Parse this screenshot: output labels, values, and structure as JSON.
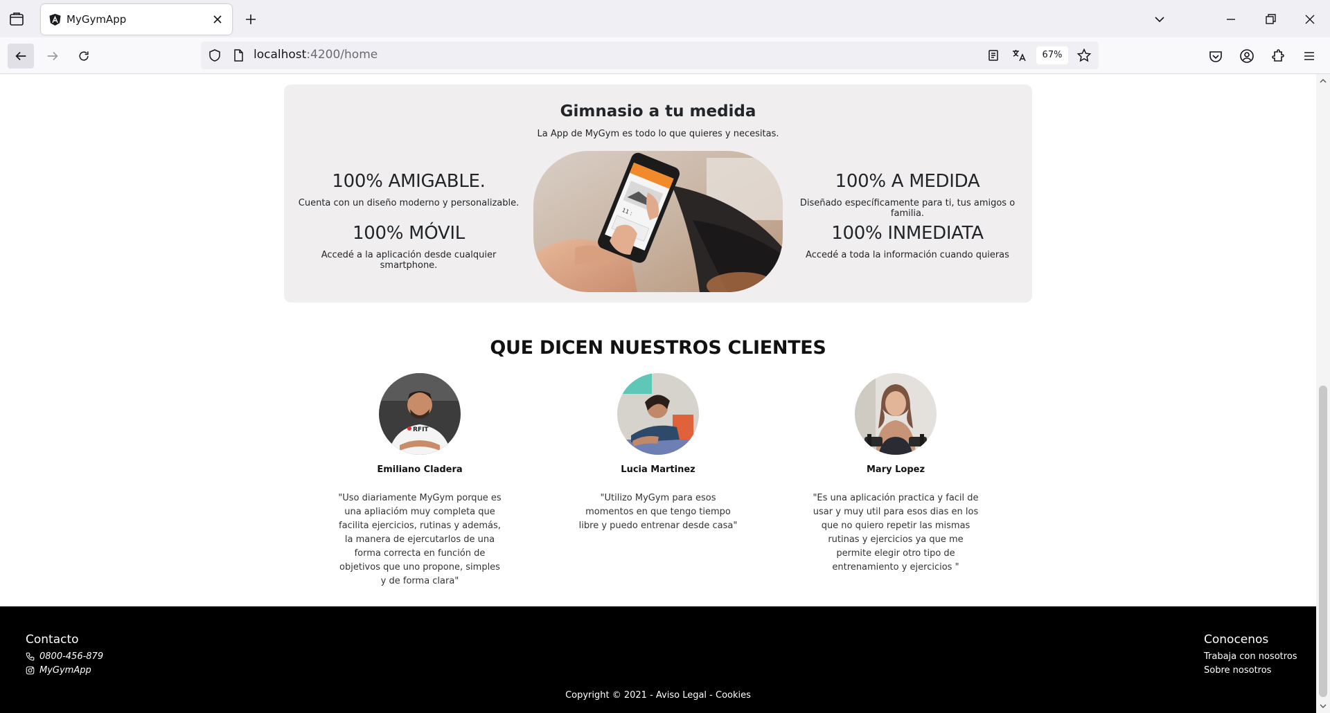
{
  "browser": {
    "tab_title": "MyGymApp",
    "url_host": "localhost",
    "url_path": ":4200/home",
    "zoom": "67%"
  },
  "features": {
    "title": "Gimnasio a tu medida",
    "subtitle": "La App de MyGym es todo lo que quieres y necesitas.",
    "items": [
      {
        "title": "100% AMIGABLE.",
        "text": "Cuenta con un diseño moderno y personalizable."
      },
      {
        "title": "100% MÓVIL",
        "text": "Accedé a la aplicación desde cualquier smartphone."
      },
      {
        "title": "100% A MEDIDA",
        "text": "Diseñado específicamente para ti, tus amigos o familia."
      },
      {
        "title": "100% INMEDIATA",
        "text": "Accedé a toda la información cuando quieras"
      }
    ],
    "phone_screen_text": "11 :"
  },
  "testimonials": {
    "heading_light": "QUE DICEN ",
    "heading_bold": "NUESTROS CLIENTES",
    "clients": [
      {
        "name": "Emiliano Cladera",
        "quote": "\"Uso diariamente MyGym porque es una apliacióm muy completa que facilita ejercicios, rutinas y además, la manera de ejercutarlos de una forma correcta en función de objetivos que uno propone, simples y de forma clara\"",
        "shirt_text": "RFIT"
      },
      {
        "name": "Lucia Martinez",
        "quote": "\"Utilizo MyGym para esos momentos en que tengo tiempo libre y puedo entrenar desde casa\""
      },
      {
        "name": "Mary Lopez",
        "quote": "\"Es una aplicación practica y facil de usar y muy util para esos dias en los que no quiero repetir las mismas rutinas y ejercicios ya que me permite elegir otro tipo de entrenamiento y ejercicios \""
      }
    ]
  },
  "footer": {
    "contact_title": "Contacto",
    "phone": "0800-456-879",
    "instagram": "MyGymApp",
    "about_title": "Conocenos",
    "links": [
      "Trabaja con nosotros",
      "Sobre nosotros"
    ],
    "copyright": "Copyright © 2021 - Aviso Legal - Cookies"
  },
  "colors": {
    "card_bg": "#f0eeee",
    "footer_bg": "#000000",
    "app_accent": "#f08a2a"
  }
}
